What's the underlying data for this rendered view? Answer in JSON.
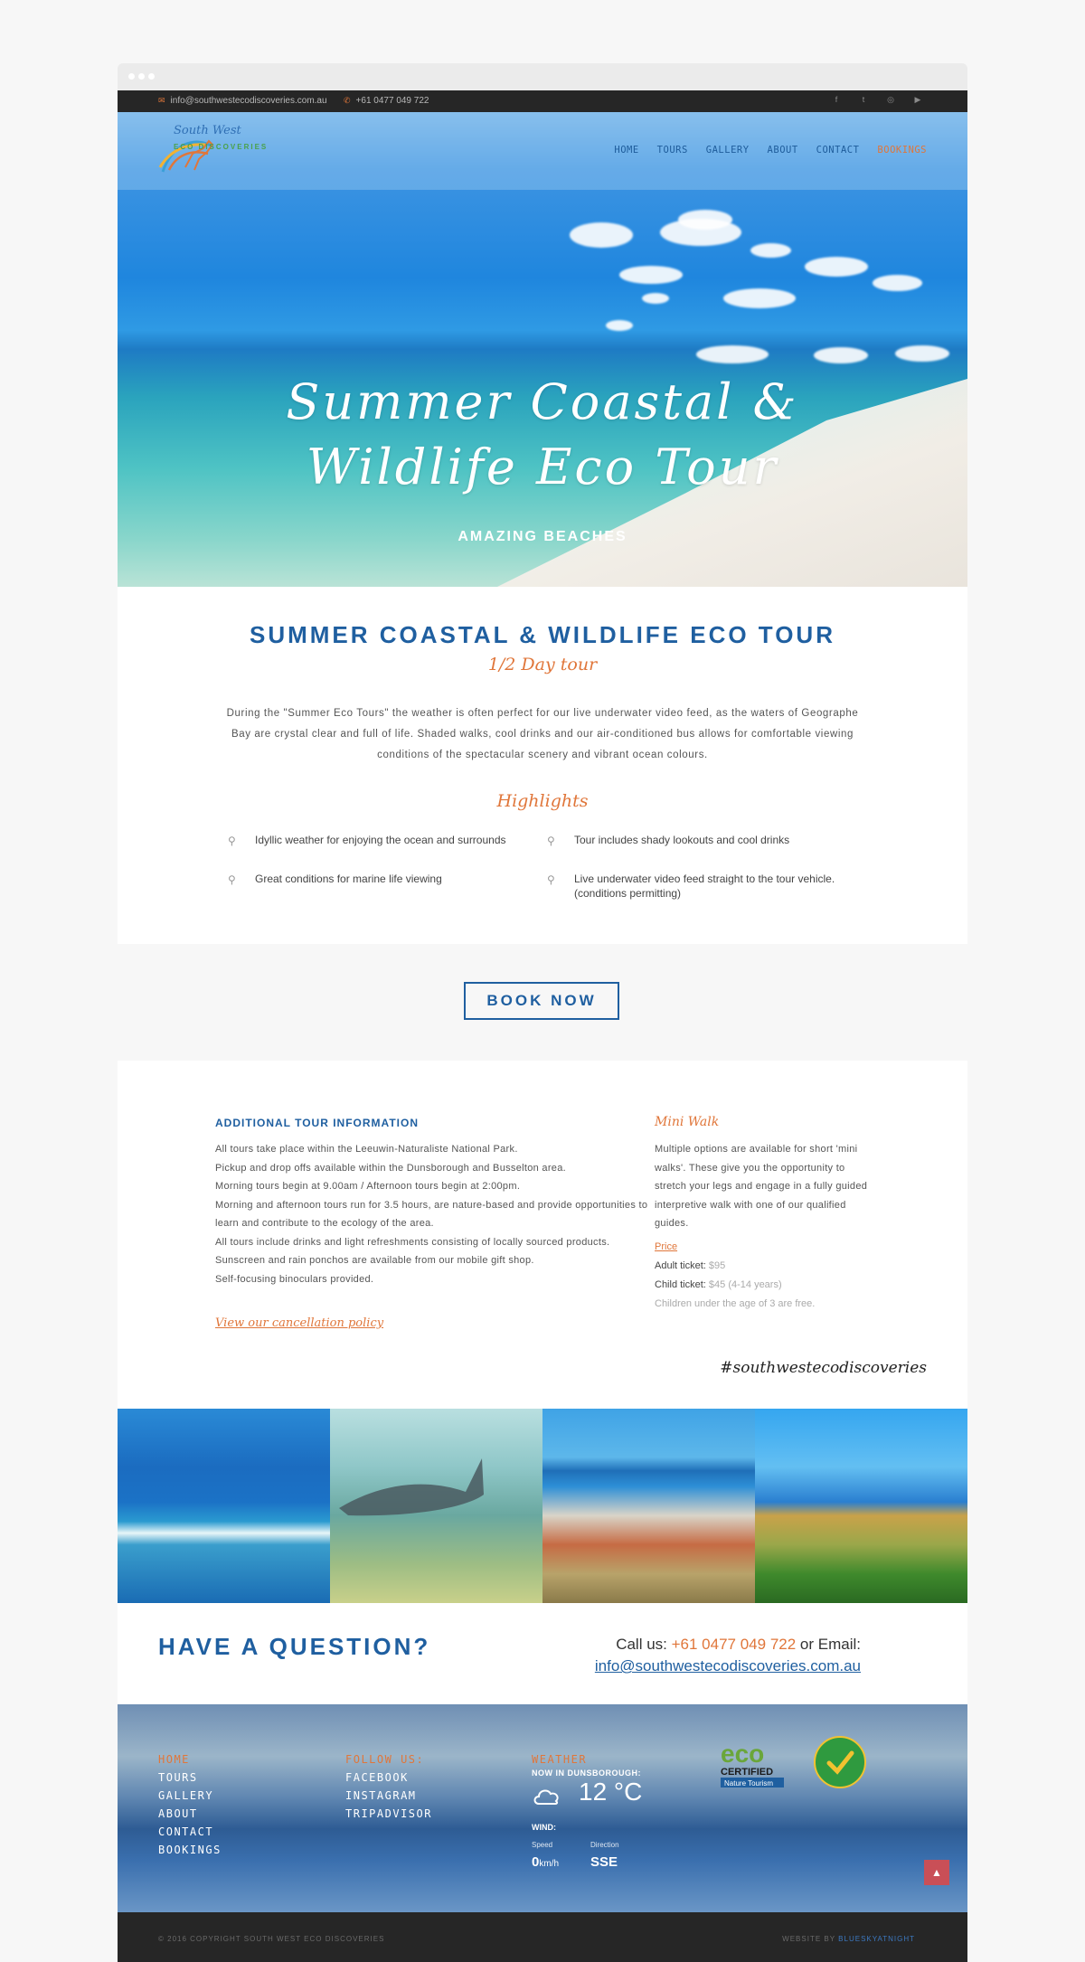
{
  "topbar": {
    "email": "info@southwestecodiscoveries.com.au",
    "phone": "+61 0477 049 722"
  },
  "logo": {
    "line1": "South West",
    "line2": "ECO DISCOVERIES"
  },
  "nav": [
    "HOME",
    "TOURS",
    "GALLERY",
    "ABOUT",
    "CONTACT",
    "BOOKINGS"
  ],
  "hero": {
    "title": "Summer Coastal & Wildlife Eco Tour",
    "subtitle": "AMAZING BEACHES"
  },
  "tour": {
    "title": "SUMMER COASTAL & WILDLIFE ECO TOUR",
    "duration": "1/2 Day tour",
    "description": "During the \"Summer Eco Tours\" the weather is often perfect for our live underwater video feed, as the waters of Geographe Bay are crystal clear and full of life. Shaded walks, cool drinks and our air-conditioned bus allows for comfortable viewing conditions of the spectacular scenery and vibrant ocean colours.",
    "highlights_title": "Highlights",
    "highlights": [
      "Idyllic weather for enjoying the ocean and surrounds",
      "Tour includes shady lookouts and cool drinks",
      "Great conditions for marine life viewing",
      "Live underwater video feed straight to the tour vehicle. (conditions permitting)"
    ]
  },
  "book_now": "BOOK NOW",
  "info": {
    "title": "ADDITIONAL TOUR INFORMATION",
    "lines": [
      "All tours take place within the Leeuwin-Naturaliste National Park.",
      "Pickup and drop offs available within the Dunsborough and Busselton area.",
      "Morning tours begin at 9.00am / Afternoon tours begin at 2:00pm.",
      "Morning and afternoon tours run for 3.5 hours, are nature-based and provide opportunities to learn and contribute to the ecology of the area.",
      "All tours include drinks and light refreshments consisting of locally sourced products.",
      "Sunscreen and rain ponchos are available from our mobile gift shop.",
      "Self-focusing binoculars provided."
    ],
    "cancel_link": "View our cancellation policy",
    "mini_title": "Mini Walk",
    "mini_text": "Multiple options are available for short 'mini walks'. These give you the opportunity to stretch your legs and engage in a fully guided interpretive walk with one of our qualified guides.",
    "price_link": "Price",
    "adult_label": "Adult ticket:",
    "adult_value": "$95",
    "child_label": "Child ticket:",
    "child_value": "$45 (4-14 years)",
    "free_note": "Children under the age of 3 are free.",
    "hashtag": "#southwestecodiscoveries"
  },
  "question": {
    "title": "HAVE A QUESTION?",
    "call_label": "Call us:",
    "phone": "+61 0477 049 722",
    "or_email": "or Email:",
    "email": "info@southwestecodiscoveries.com.au"
  },
  "footer": {
    "nav": [
      "HOME",
      "TOURS",
      "GALLERY",
      "ABOUT",
      "CONTACT",
      "BOOKINGS"
    ],
    "follow_title": "FOLLOW US:",
    "follow": [
      "FACEBOOK",
      "INSTAGRAM",
      "TRIPADVISOR"
    ],
    "weather_title": "WEATHER",
    "weather_now": "NOW IN DUNSBOROUGH:",
    "temp": "12 °C",
    "wind_title": "WIND:",
    "speed_label": "Speed",
    "speed_value": "0",
    "speed_unit": "km/h",
    "direction_label": "Direction",
    "direction_value": "SSE"
  },
  "copyright": "© 2016 COPYRIGHT SOUTH WEST ECO DISCOVERIES",
  "website_by_label": "WEBSITE BY",
  "website_by": "BLUESKYATNIGHT",
  "colors": {
    "accent": "#e0763a",
    "brand": "#1f5fa0",
    "dark": "#262626"
  }
}
